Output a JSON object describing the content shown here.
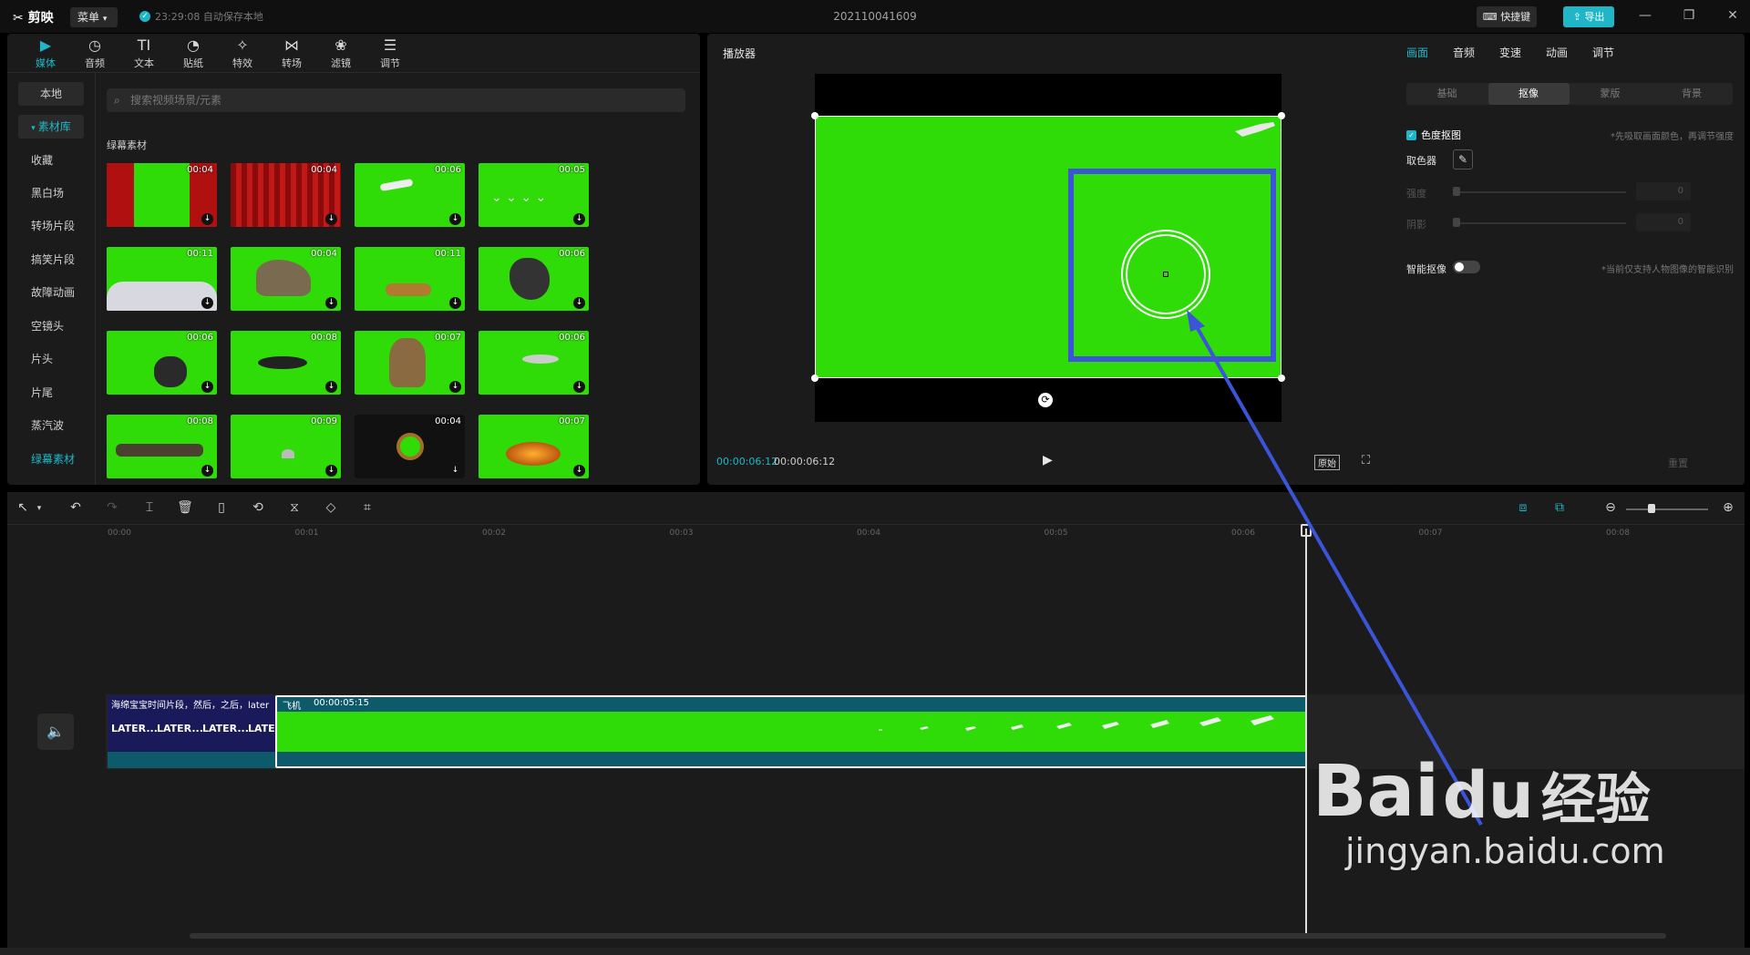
{
  "titlebar": {
    "logo": "剪映",
    "menu_label": "菜单",
    "autosave": "23:29:08 自动保存本地",
    "project": "202110041609",
    "shortcut_label": "快捷键",
    "export_label": "导出"
  },
  "media": {
    "tabs": [
      {
        "icon": "media-icon",
        "label": "媒体"
      },
      {
        "icon": "audio-icon",
        "label": "音频"
      },
      {
        "icon": "text-icon",
        "label": "文本"
      },
      {
        "icon": "sticker-icon",
        "label": "贴纸"
      },
      {
        "icon": "effects-icon",
        "label": "特效"
      },
      {
        "icon": "transition-icon",
        "label": "转场"
      },
      {
        "icon": "filter-icon",
        "label": "滤镜"
      },
      {
        "icon": "adjust-icon",
        "label": "调节"
      }
    ],
    "sidebar": [
      "本地",
      "素材库",
      "收藏",
      "黑白场",
      "转场片段",
      "搞笑片段",
      "故障动画",
      "空镜头",
      "片头",
      "片尾",
      "蒸汽波",
      "绿幕素材"
    ],
    "search_placeholder": "搜索视频场景/元素",
    "section_title": "绿幕素材",
    "thumbs": [
      {
        "dur": "00:04",
        "kind": "curtain-open"
      },
      {
        "dur": "00:04",
        "kind": "curtain"
      },
      {
        "dur": "00:06",
        "kind": "plane"
      },
      {
        "dur": "00:05",
        "kind": "birds"
      },
      {
        "dur": "00:11",
        "kind": "clouds"
      },
      {
        "dur": "00:04",
        "kind": "dino"
      },
      {
        "dur": "00:11",
        "kind": "tiger"
      },
      {
        "dur": "00:06",
        "kind": "rock"
      },
      {
        "dur": "00:06",
        "kind": "meteor"
      },
      {
        "dur": "00:08",
        "kind": "whale"
      },
      {
        "dur": "00:07",
        "kind": "dino2"
      },
      {
        "dur": "00:06",
        "kind": "shark"
      },
      {
        "dur": "00:08",
        "kind": "crack"
      },
      {
        "dur": "00:09",
        "kind": "fin"
      },
      {
        "dur": "00:04",
        "kind": "mgm"
      },
      {
        "dur": "00:07",
        "kind": "explosion"
      }
    ]
  },
  "player": {
    "label": "播放器",
    "current_time": "00:00:06:12",
    "total_time": "00:00:06:12",
    "original_label": "原始"
  },
  "inspector": {
    "tabs": [
      "画面",
      "音频",
      "变速",
      "动画",
      "调节"
    ],
    "segments": [
      "基础",
      "抠像",
      "蒙版",
      "背景"
    ],
    "chroma_label": "色度抠图",
    "chroma_hint": "*先吸取画面颜色，再调节强度",
    "picker_label": "取色器",
    "strength_label": "强度",
    "strength_value": "0",
    "shadow_label": "阴影",
    "shadow_value": "0",
    "smart_label": "智能抠像",
    "smart_hint": "*当前仅支持人物图像的智能识别",
    "reset_label": "重置"
  },
  "timeline": {
    "ticks": [
      "00:00",
      "00:01",
      "00:02",
      "00:03",
      "00:04",
      "00:05",
      "00:06",
      "00:07",
      "00:08"
    ],
    "clip_a_label": "海绵宝宝时间片段，然后，之后，later",
    "clip_a_text": "LATER...",
    "clip_b_name": "飞机",
    "clip_b_dur": "00:00:05:15"
  },
  "watermark": {
    "brand": "Bai",
    "brand2": "du",
    "brand3": "经验",
    "url": "jingyan.baidu.com"
  },
  "colors": {
    "accent": "#1fb7c8",
    "greenscreen": "#2fdc07",
    "annotation": "#3b54d8"
  }
}
